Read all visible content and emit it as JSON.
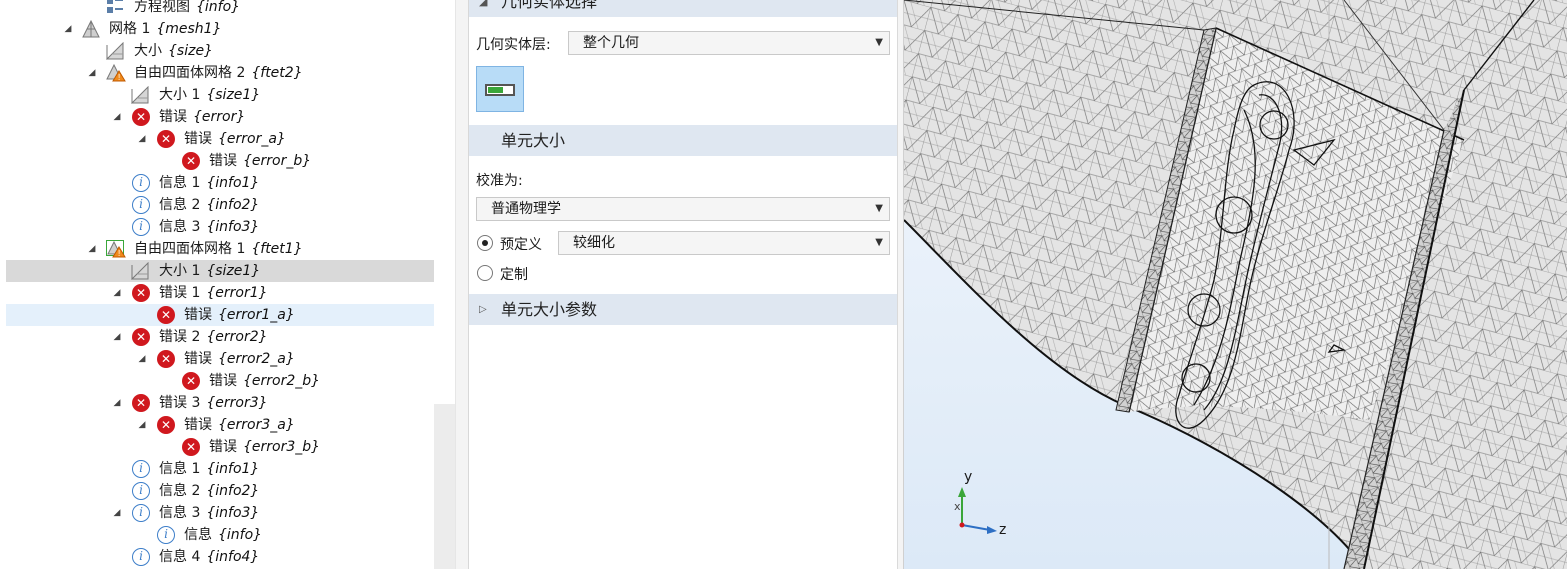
{
  "tree": {
    "rows": [
      {
        "label": "方程视图",
        "tag": "{info}"
      },
      {
        "label": "网格 1",
        "tag": "{mesh1}"
      },
      {
        "label": "大小",
        "tag": "{size}"
      },
      {
        "label": "自由四面体网格 2",
        "tag": "{ftet2}"
      },
      {
        "label": "大小 1",
        "tag": "{size1}"
      },
      {
        "label": "错误",
        "tag": "{error}"
      },
      {
        "label": "错误",
        "tag": "{error_a}"
      },
      {
        "label": "错误",
        "tag": "{error_b}"
      },
      {
        "label": "信息 1",
        "tag": "{info1}"
      },
      {
        "label": "信息 2",
        "tag": "{info2}"
      },
      {
        "label": "信息 3",
        "tag": "{info3}"
      },
      {
        "label": "自由四面体网格 1",
        "tag": "{ftet1}"
      },
      {
        "label": "大小 1",
        "tag": "{size1}"
      },
      {
        "label": "错误 1",
        "tag": "{error1}"
      },
      {
        "label": "错误",
        "tag": "{error1_a}"
      },
      {
        "label": "错误 2",
        "tag": "{error2}"
      },
      {
        "label": "错误",
        "tag": "{error2_a}"
      },
      {
        "label": "错误",
        "tag": "{error2_b}"
      },
      {
        "label": "错误 3",
        "tag": "{error3}"
      },
      {
        "label": "错误",
        "tag": "{error3_a}"
      },
      {
        "label": "错误",
        "tag": "{error3_b}"
      },
      {
        "label": "信息 1",
        "tag": "{info1}"
      },
      {
        "label": "信息 2",
        "tag": "{info2}"
      },
      {
        "label": "信息 3",
        "tag": "{info3}"
      },
      {
        "label": "信息",
        "tag": "{info}"
      },
      {
        "label": "信息 4",
        "tag": "{info4}"
      }
    ]
  },
  "settings": {
    "geom_section_title": "几何实体选择",
    "geom_level_label": "几何实体层:",
    "geom_level_value": "整个几何",
    "element_size_title": "单元大小",
    "calibrate_label": "校准为:",
    "calibrate_value": "普通物理学",
    "predefined_label": "预定义",
    "predefined_value": "较细化",
    "custom_label": "定制",
    "element_size_params_title": "单元大小参数"
  },
  "graphics": {
    "axis_y": "y",
    "axis_z": "z",
    "axis_x": "x"
  },
  "colors": {
    "error": "#d0181e",
    "info": "#3d7ec9",
    "selected_row": "#d9d9d9",
    "hover_row": "#e4f0fb",
    "section_header": "#dfe7f1",
    "viewport_bg": "#dce9f7"
  }
}
